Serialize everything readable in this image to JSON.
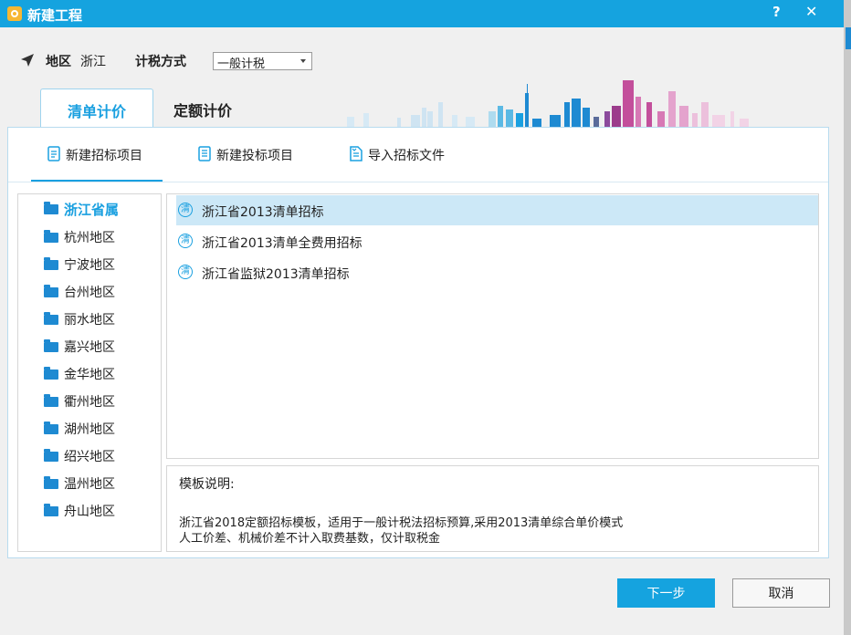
{
  "window": {
    "title": "新建工程",
    "help_label": "?",
    "close_label": "✕"
  },
  "region": {
    "label": "地区",
    "value": "浙江"
  },
  "tax": {
    "label": "计税方式",
    "selected": "一般计税"
  },
  "tabs": [
    {
      "label": "清单计价",
      "active": true
    },
    {
      "label": "定额计价",
      "active": false
    }
  ],
  "subtabs": [
    {
      "label": "新建招标项目",
      "icon": "document-icon",
      "active": true
    },
    {
      "label": "新建投标项目",
      "icon": "document-list-icon",
      "active": false
    },
    {
      "label": "导入招标文件",
      "icon": "import-file-icon",
      "active": false
    }
  ],
  "regions": [
    {
      "label": "浙江省属",
      "active": true
    },
    {
      "label": "杭州地区"
    },
    {
      "label": "宁波地区"
    },
    {
      "label": "台州地区"
    },
    {
      "label": "丽水地区"
    },
    {
      "label": "嘉兴地区"
    },
    {
      "label": "金华地区"
    },
    {
      "label": "衢州地区"
    },
    {
      "label": "湖州地区"
    },
    {
      "label": "绍兴地区"
    },
    {
      "label": "温州地区"
    },
    {
      "label": "舟山地区"
    }
  ],
  "templates": [
    {
      "badge": "清",
      "label": "浙江省2013清单招标",
      "selected": true
    },
    {
      "badge": "清",
      "label": "浙江省2013清单全费用招标"
    },
    {
      "badge": "清",
      "label": "浙江省监狱2013清单招标"
    }
  ],
  "description": {
    "title": "模板说明:",
    "line1": "浙江省2018定额招标模板，适用于一般计税法招标预算,采用2013清单综合单价模式",
    "line2": "人工价差、机械价差不计入取费基数，仅计取税金"
  },
  "buttons": {
    "next": "下一步",
    "cancel": "取消"
  },
  "colors": {
    "accent": "#15a3df",
    "folder": "#1e8ad2",
    "selected_row": "#cce8f7"
  }
}
